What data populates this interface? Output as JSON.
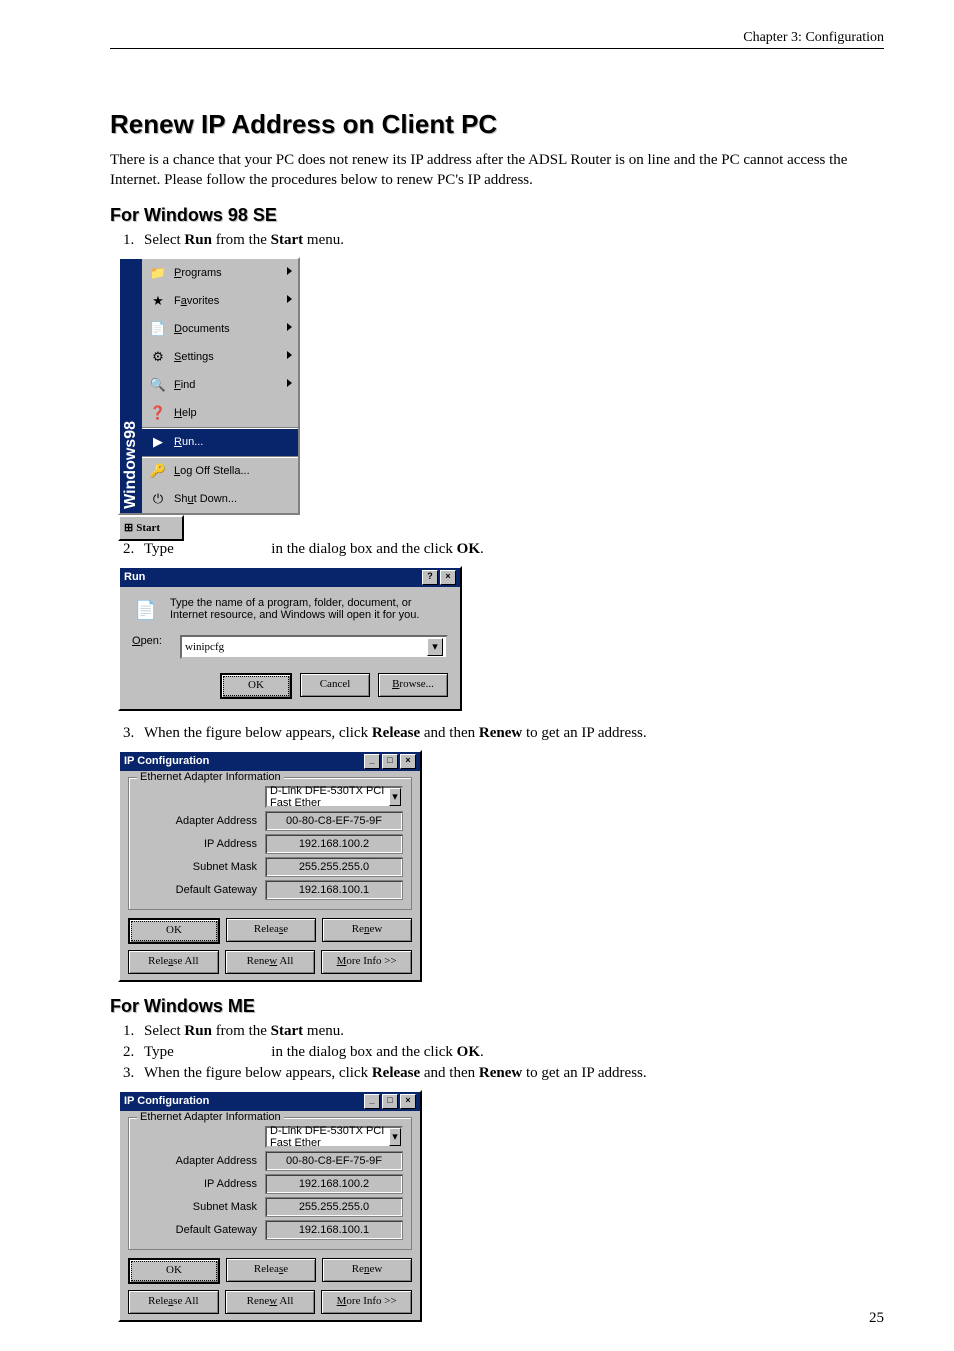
{
  "header": {
    "chapter": "Chapter 3: Configuration"
  },
  "h1": "Renew IP Address on Client PC",
  "intro": "There is a chance that your PC does not renew its IP address after the ADSL Router is on line and the PC cannot access the Internet. Please follow the procedures below to renew PC's IP address.",
  "sec98": {
    "title": "For Windows 98 SE",
    "steps": {
      "s1_a": "Select ",
      "s1_b": "Run",
      "s1_c": " from the ",
      "s1_d": "Start",
      "s1_e": " menu.",
      "s2_a": "Type",
      "s2_b": "in the dialog box and the click ",
      "s2_c": "OK",
      "s2_d": ".",
      "s3_a": "When the figure below appears, click ",
      "s3_b": "Release",
      "s3_c": " and then ",
      "s3_d": "Renew",
      "s3_e": " to get an IP address."
    }
  },
  "secME": {
    "title": "For Windows ME",
    "steps": {
      "s1_a": "Select ",
      "s1_b": "Run",
      "s1_c": " from the ",
      "s1_d": "Start",
      "s1_e": " menu.",
      "s2_a": "Type",
      "s2_b": "in the dialog box and the click ",
      "s2_c": "OK",
      "s2_d": ".",
      "s3_a": "When the figure below appears, click ",
      "s3_b": "Release",
      "s3_c": " and then ",
      "s3_d": "Renew",
      "s3_e": " to get an IP address."
    }
  },
  "startmenu": {
    "sidebar": "Windows98",
    "items": [
      {
        "icon": "📁",
        "label": "Programs",
        "arrow": true
      },
      {
        "icon": "★",
        "label": "Favorites",
        "arrow": true
      },
      {
        "icon": "📄",
        "label": "Documents",
        "arrow": true
      },
      {
        "icon": "⚙",
        "label": "Settings",
        "arrow": true
      },
      {
        "icon": "🔍",
        "label": "Find",
        "arrow": true
      },
      {
        "icon": "❓",
        "label": "Help",
        "arrow": false
      },
      {
        "icon": "▶",
        "label": "Run...",
        "arrow": false,
        "highlight": true,
        "sep": true
      },
      {
        "icon": "🔑",
        "label": "Log Off Stella...",
        "arrow": false,
        "sep": true
      },
      {
        "icon": "⏻",
        "label": "Shut Down...",
        "arrow": false
      }
    ],
    "start_btn": "Start"
  },
  "run": {
    "title": "Run",
    "help_btn": "?",
    "close_btn": "×",
    "desc": "Type the name of a program, folder, document, or Internet resource, and Windows will open it for you.",
    "open_label": "Open:",
    "open_value": "winipcfg",
    "ok": "OK",
    "cancel": "Cancel",
    "browse": "Browse..."
  },
  "ipcfg": {
    "title": "IP Configuration",
    "min": "_",
    "max": "□",
    "close": "×",
    "group": "Ethernet Adapter Information",
    "adapter_sel": "D-Link DFE-530TX PCI Fast Ether",
    "rows": {
      "adapter_addr_l": "Adapter Address",
      "adapter_addr_v": "00-80-C8-EF-75-9F",
      "ip_l": "IP Address",
      "ip_v": "192.168.100.2",
      "mask_l": "Subnet Mask",
      "mask_v": "255.255.255.0",
      "gw_l": "Default Gateway",
      "gw_v": "192.168.100.1"
    },
    "buttons": {
      "ok": "OK",
      "release": "Release",
      "renew": "Renew",
      "release_all": "Release All",
      "renew_all": "Renew All",
      "more": "More Info >>"
    }
  },
  "page_number": "25"
}
